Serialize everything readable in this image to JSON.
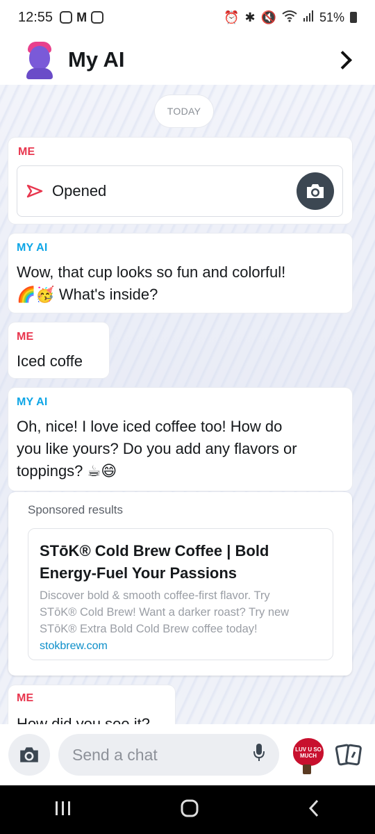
{
  "status_bar": {
    "time": "12:55",
    "battery": "51%"
  },
  "header": {
    "title": "My AI"
  },
  "chat": {
    "date_divider": "TODAY",
    "messages": [
      {
        "sender": "ME",
        "type": "snap",
        "text": "Opened"
      },
      {
        "sender": "MY AI",
        "line1": "Wow, that cup looks so fun and colorful!",
        "line2": "What's inside?",
        "emoji": "🌈🥳"
      },
      {
        "sender": "ME",
        "text": "Iced coffe"
      },
      {
        "sender": "MY AI",
        "line1": "Oh, nice! I love iced coffee too! How do",
        "line2": "you like yours? Do you add any flavors or",
        "line3": "toppings?",
        "emoji": "☕😄"
      },
      {
        "sender": "ME",
        "text": "How did you see it?"
      }
    ]
  },
  "sponsored": {
    "label": "Sponsored results",
    "ad": {
      "title_line1": "STōK® Cold Brew Coffee | Bold",
      "title_line2": "Energy-Fuel Your Passions",
      "desc_line1": "Discover bold & smooth coffee-first flavor. Try",
      "desc_line2": "STōK® Cold Brew! Want a darker roast? Try new",
      "desc_line3": "STōK® Extra Bold Cold Brew coffee today!",
      "link": "stokbrew.com"
    }
  },
  "composer": {
    "placeholder": "Send a chat",
    "sticker_text": "LUV U SO MUCH"
  },
  "colors": {
    "me": "#e8364e",
    "ai": "#0fa6e6",
    "link": "#0b8ec9"
  }
}
